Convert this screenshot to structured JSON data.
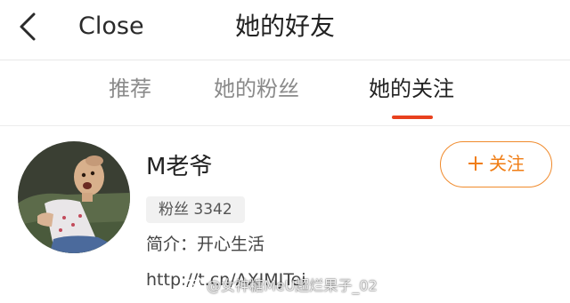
{
  "header": {
    "back_icon": "chevron-left-icon",
    "close_label": "Close",
    "title": "她的好友"
  },
  "tabs": [
    {
      "label": "推荐",
      "active": false
    },
    {
      "label": "她的粉丝",
      "active": false
    },
    {
      "label": "她的关注",
      "active": true
    }
  ],
  "accent_color": "#e8411e",
  "follow_color": "#f07d14",
  "user": {
    "name": "M老爷",
    "fans": "粉丝 3342",
    "bio": "简介：开心生活",
    "link": "http://t.cn/AXIMJTei",
    "follow_label": "关注",
    "follow_icon": "plus-icon"
  },
  "watermark": {
    "text": "@女神糖MeU超烂果子_02",
    "icon": "weibo-logo"
  }
}
